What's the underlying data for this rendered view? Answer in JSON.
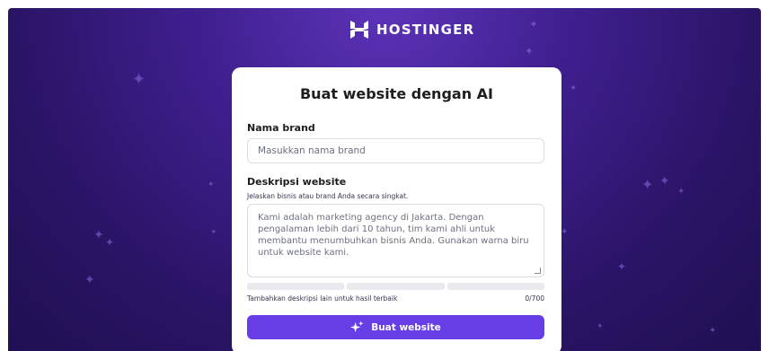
{
  "brand": {
    "name": "HOSTINGER"
  },
  "card": {
    "title": "Buat website dengan AI",
    "brand_label": "Nama brand",
    "brand_placeholder": "Masukkan nama brand",
    "desc_label": "Deskripsi website",
    "desc_hint": "Jelaskan bisnis atau brand Anda secara singkat.",
    "desc_placeholder": "Kami adalah marketing agency di Jakarta. Dengan pengalaman lebih dari 10 tahun, tim kami ahli untuk membantu menumbuhkan bisnis Anda. Gunakan warna biru untuk website kami.",
    "progress_segments_filled": 0,
    "progress_segments_total": 3,
    "footer_hint": "Tambahkan deskripsi lain untuk hasil terbaik",
    "counter": "0/700",
    "submit_label": "Buat website"
  },
  "colors": {
    "background": "#2a1466",
    "accent": "#673de6",
    "card": "#ffffff"
  },
  "icons": {
    "logo": "hostinger-logo-icon",
    "submit": "sparkle-icon"
  }
}
